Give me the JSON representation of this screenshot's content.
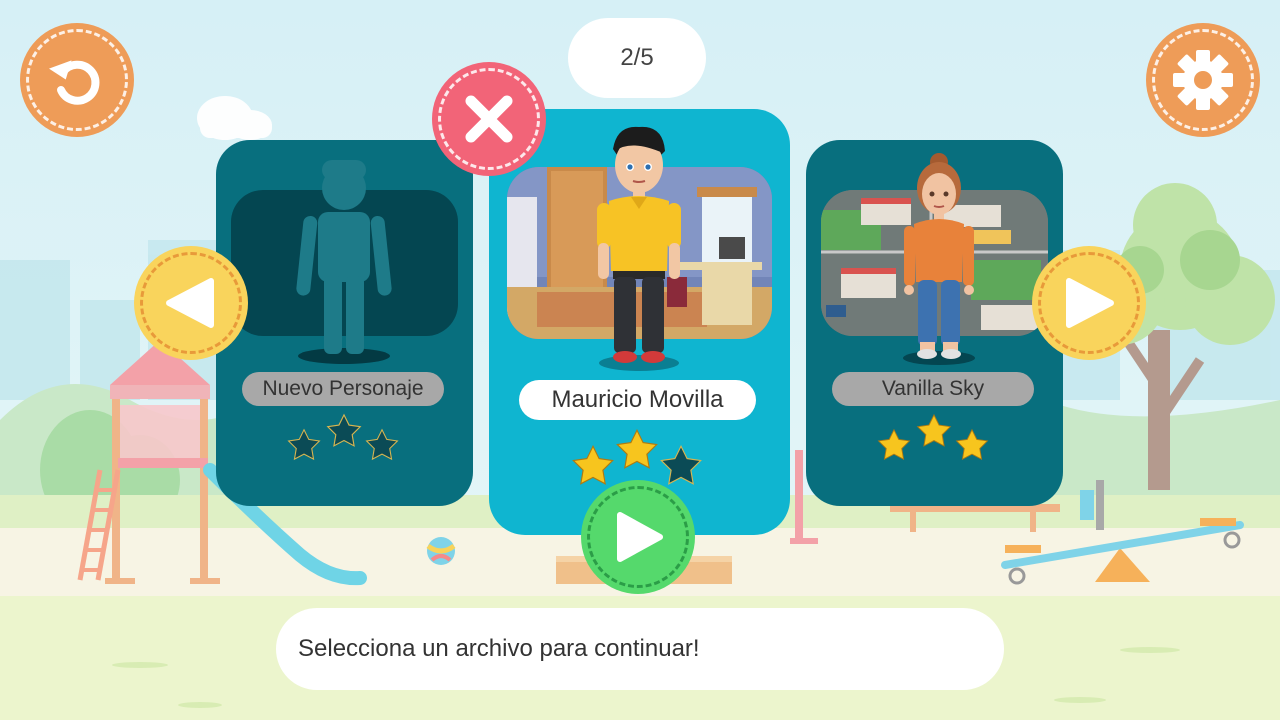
{
  "hud": {
    "counter": "2/5",
    "back_icon": "undo-arrow-icon",
    "settings_icon": "gear-icon",
    "delete_icon": "close-x-icon",
    "prev_icon": "triangle-left-icon",
    "next_icon": "triangle-right-icon",
    "play_icon": "play-triangle-icon"
  },
  "characters": [
    {
      "name": "Nuevo Personaje",
      "stars_earned": 0,
      "stars_total": 3,
      "avatar": "silhouette",
      "background": "empty"
    },
    {
      "name": "Mauricio Movilla",
      "stars_earned": 2,
      "stars_total": 3,
      "avatar": "boy-yellow-shirt",
      "background": "bedroom"
    },
    {
      "name": "Vanilla Sky",
      "stars_earned": 3,
      "stars_total": 3,
      "avatar": "girl-orange-shirt",
      "background": "city"
    }
  ],
  "message": "Selecciona un archivo para continuar!",
  "colors": {
    "sky": "#d8f1f7",
    "grass": "#eef6d6",
    "card_side": "#086f7e",
    "card_center": "#0fb5d0",
    "orange_button": "#ee9c58",
    "yellow_button": "#f9d45c",
    "close_button": "#f26478",
    "play_button": "#55d96c",
    "star_gold": "#f7c51e",
    "star_empty": "#0b4b56"
  }
}
